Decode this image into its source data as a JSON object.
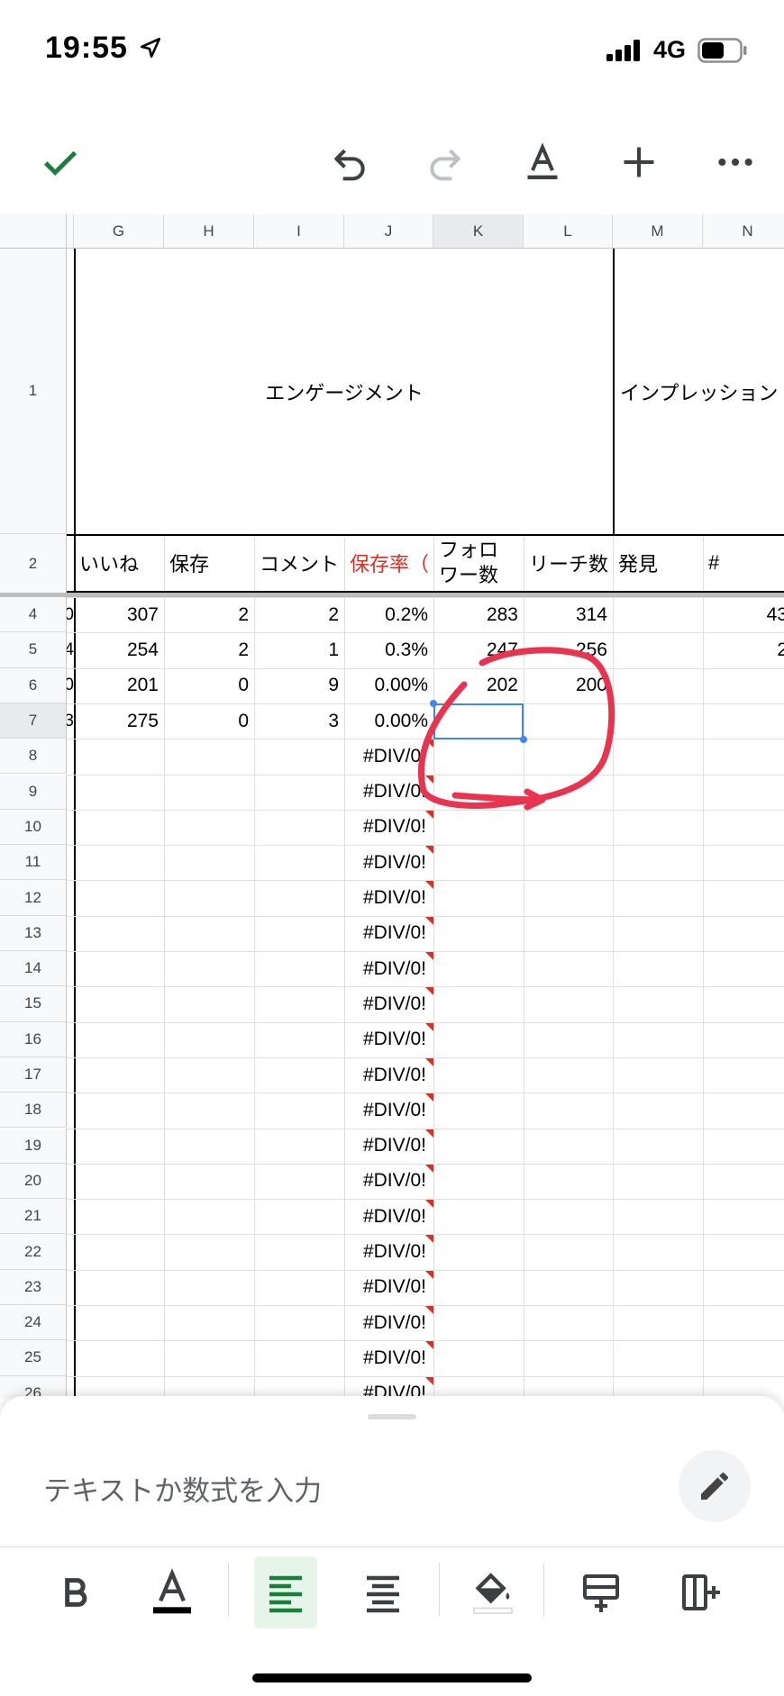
{
  "status_bar": {
    "time": "19:55",
    "network": "4G"
  },
  "toolbar": {
    "confirm_icon": "check-icon",
    "undo_icon": "undo-icon",
    "redo_icon": "redo-icon",
    "text_format_icon": "text-format-icon",
    "insert_icon": "plus-icon",
    "more_icon": "more-icon"
  },
  "grid": {
    "columns": [
      "G",
      "H",
      "I",
      "J",
      "K",
      "L",
      "M",
      "N"
    ],
    "selected_column": "K",
    "rows": [
      "1",
      "2",
      "4",
      "5",
      "6",
      "7",
      "8",
      "9",
      "10",
      "11",
      "12",
      "13",
      "14",
      "15",
      "16",
      "17",
      "18",
      "19",
      "20",
      "21",
      "22",
      "23",
      "24",
      "25",
      "26"
    ],
    "selected_row": "7",
    "merged_header_engagement": "エンゲージメント",
    "merged_header_impressions": "インプレッション",
    "row2_labels": {
      "G": "いいね",
      "H": "保存",
      "I": "コメント",
      "J": "保存率（",
      "K": "フォロワー数",
      "L": "リーチ数",
      "M": "発見",
      "N": "#"
    },
    "data_rows": [
      {
        "partial_F": "0",
        "G": "307",
        "H": "2",
        "I": "2",
        "J": "0.2%",
        "K": "283",
        "L": "314",
        "N": "43"
      },
      {
        "partial_F": "4",
        "G": "254",
        "H": "2",
        "I": "1",
        "J": "0.3%",
        "K": "247",
        "L": "256",
        "N": "2"
      },
      {
        "partial_F": "0",
        "G": "201",
        "H": "0",
        "I": "9",
        "J": "0.00%",
        "K": "202",
        "L": "200",
        "N": ""
      },
      {
        "partial_F": "3",
        "G": "275",
        "H": "0",
        "I": "3",
        "J": "0.00%",
        "K": "",
        "L": "",
        "N": ""
      }
    ],
    "error_text": "#DIV/0!",
    "accent_colors": {
      "selection": "#4285f4",
      "annotation": "#e8344e",
      "error_mark": "#d93025",
      "red_header": "#d93025"
    }
  },
  "bottom_sheet": {
    "formula_placeholder": "テキストか数式を入力",
    "edit_icon": "pencil-icon",
    "format_buttons": [
      "bold-icon",
      "text-color-icon",
      "align-left-icon",
      "align-center-icon",
      "fill-color-icon",
      "insert-row-icon",
      "insert-column-icon"
    ],
    "active_format": "align-left-icon"
  }
}
